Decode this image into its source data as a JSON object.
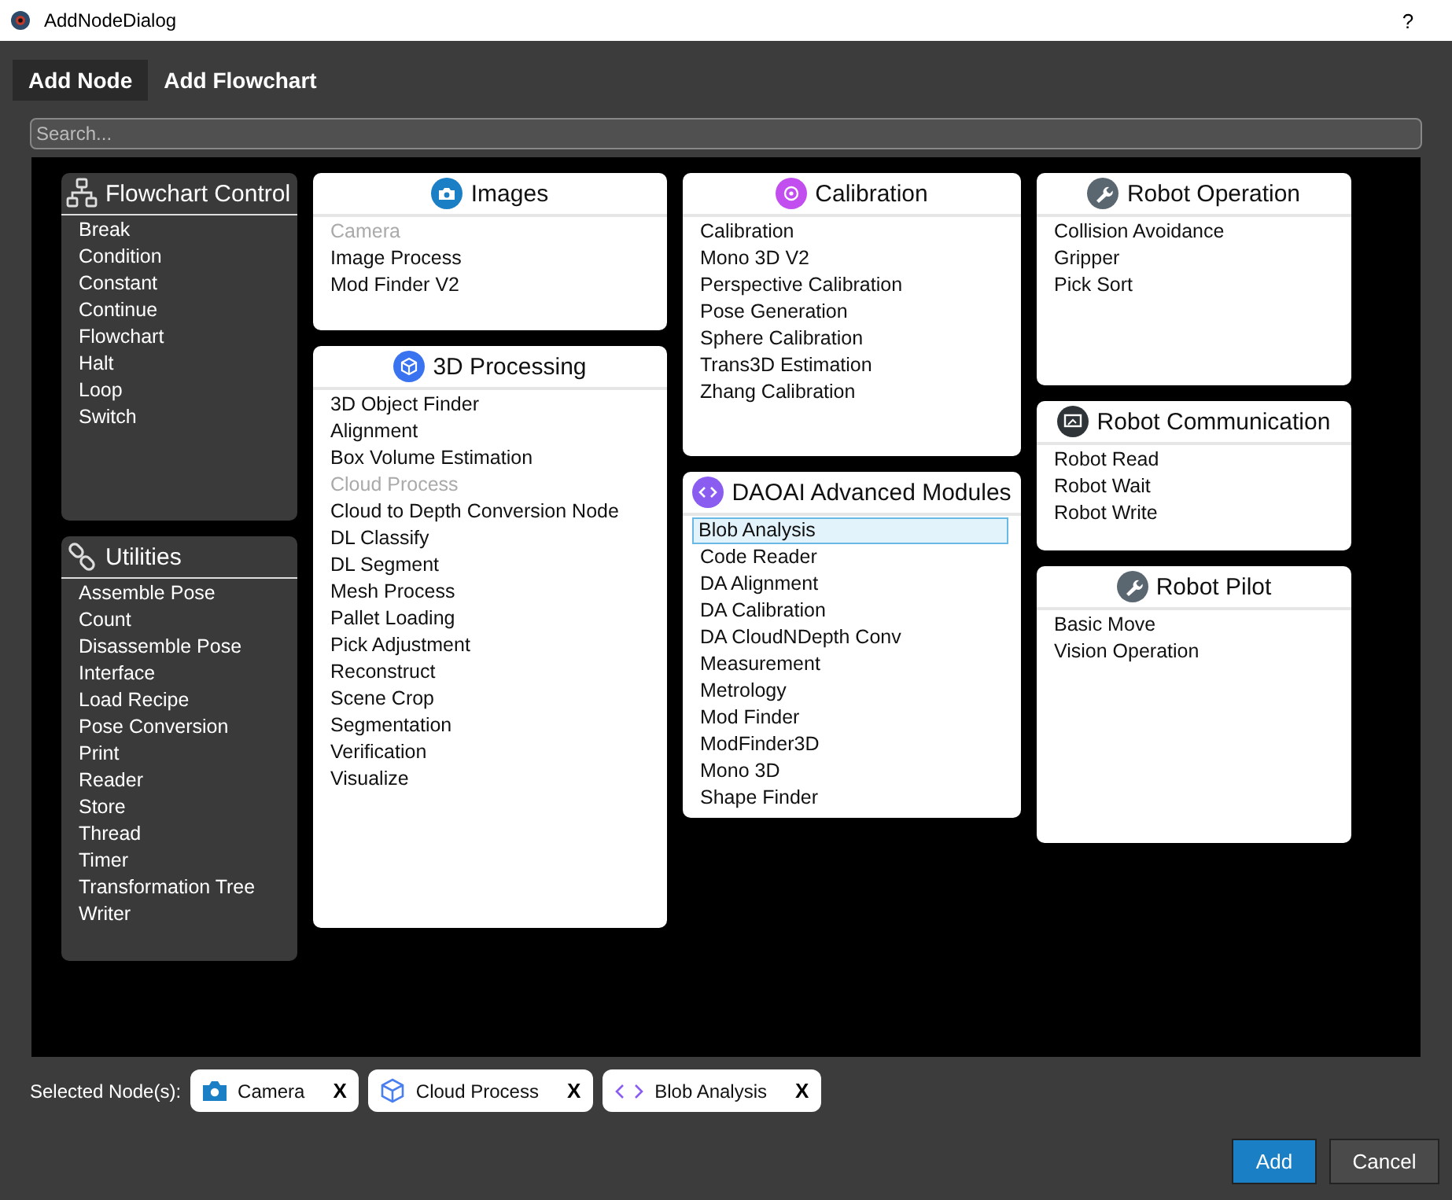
{
  "window": {
    "title": "AddNodeDialog",
    "help": "?"
  },
  "tabs": [
    {
      "label": "Add Node",
      "selected": true
    },
    {
      "label": "Add Flowchart",
      "selected": false
    }
  ],
  "search": {
    "placeholder": "Search..."
  },
  "columns": [
    {
      "cards": [
        {
          "title": "Flowchart Control",
          "items": [
            {
              "label": "Break",
              "disabled": false,
              "selected": false
            },
            {
              "label": "Condition",
              "disabled": false,
              "selected": false
            },
            {
              "label": "Constant",
              "disabled": false,
              "selected": false
            },
            {
              "label": "Continue",
              "disabled": false,
              "selected": false
            },
            {
              "label": "Flowchart",
              "disabled": false,
              "selected": false
            },
            {
              "label": "Halt",
              "disabled": false,
              "selected": false
            },
            {
              "label": "Loop",
              "disabled": false,
              "selected": false
            },
            {
              "label": "Switch",
              "disabled": false,
              "selected": false
            }
          ]
        },
        {
          "title": "Utilities",
          "items": [
            {
              "label": "Assemble Pose",
              "disabled": false,
              "selected": false
            },
            {
              "label": "Count",
              "disabled": false,
              "selected": false
            },
            {
              "label": "Disassemble Pose",
              "disabled": false,
              "selected": false
            },
            {
              "label": "Interface",
              "disabled": false,
              "selected": false
            },
            {
              "label": "Load Recipe",
              "disabled": false,
              "selected": false
            },
            {
              "label": "Pose Conversion",
              "disabled": false,
              "selected": false
            },
            {
              "label": "Print",
              "disabled": false,
              "selected": false
            },
            {
              "label": "Reader",
              "disabled": false,
              "selected": false
            },
            {
              "label": "Store",
              "disabled": false,
              "selected": false
            },
            {
              "label": "Thread",
              "disabled": false,
              "selected": false
            },
            {
              "label": "Timer",
              "disabled": false,
              "selected": false
            },
            {
              "label": "Transformation Tree",
              "disabled": false,
              "selected": false
            },
            {
              "label": "Writer",
              "disabled": false,
              "selected": false
            }
          ]
        }
      ]
    },
    {
      "cards": [
        {
          "title": "Images",
          "items": [
            {
              "label": "Camera",
              "disabled": true,
              "selected": false
            },
            {
              "label": "Image Process",
              "disabled": false,
              "selected": false
            },
            {
              "label": "Mod Finder V2",
              "disabled": false,
              "selected": false
            }
          ]
        },
        {
          "title": "3D Processing",
          "items": [
            {
              "label": "3D Object Finder",
              "disabled": false,
              "selected": false
            },
            {
              "label": "Alignment",
              "disabled": false,
              "selected": false
            },
            {
              "label": "Box Volume Estimation",
              "disabled": false,
              "selected": false
            },
            {
              "label": "Cloud Process",
              "disabled": true,
              "selected": false
            },
            {
              "label": "Cloud to Depth Conversion Node",
              "disabled": false,
              "selected": false
            },
            {
              "label": "DL Classify",
              "disabled": false,
              "selected": false
            },
            {
              "label": "DL Segment",
              "disabled": false,
              "selected": false
            },
            {
              "label": "Mesh Process",
              "disabled": false,
              "selected": false
            },
            {
              "label": "Pallet Loading",
              "disabled": false,
              "selected": false
            },
            {
              "label": "Pick Adjustment",
              "disabled": false,
              "selected": false
            },
            {
              "label": "Reconstruct",
              "disabled": false,
              "selected": false
            },
            {
              "label": "Scene Crop",
              "disabled": false,
              "selected": false
            },
            {
              "label": "Segmentation",
              "disabled": false,
              "selected": false
            },
            {
              "label": "Verification",
              "disabled": false,
              "selected": false
            },
            {
              "label": "Visualize",
              "disabled": false,
              "selected": false
            }
          ]
        }
      ]
    },
    {
      "cards": [
        {
          "title": "Calibration",
          "items": [
            {
              "label": "Calibration",
              "disabled": false,
              "selected": false
            },
            {
              "label": "Mono 3D V2",
              "disabled": false,
              "selected": false
            },
            {
              "label": "Perspective Calibration",
              "disabled": false,
              "selected": false
            },
            {
              "label": "Pose Generation",
              "disabled": false,
              "selected": false
            },
            {
              "label": "Sphere Calibration",
              "disabled": false,
              "selected": false
            },
            {
              "label": "Trans3D Estimation",
              "disabled": false,
              "selected": false
            },
            {
              "label": "Zhang Calibration",
              "disabled": false,
              "selected": false
            }
          ]
        },
        {
          "title": "DAOAI Advanced Modules",
          "items": [
            {
              "label": "Blob Analysis",
              "disabled": false,
              "selected": true
            },
            {
              "label": "Code Reader",
              "disabled": false,
              "selected": false
            },
            {
              "label": "DA Alignment",
              "disabled": false,
              "selected": false
            },
            {
              "label": "DA Calibration",
              "disabled": false,
              "selected": false
            },
            {
              "label": "DA CloudNDepth Conv",
              "disabled": false,
              "selected": false
            },
            {
              "label": "Measurement",
              "disabled": false,
              "selected": false
            },
            {
              "label": "Metrology",
              "disabled": false,
              "selected": false
            },
            {
              "label": "Mod Finder",
              "disabled": false,
              "selected": false
            },
            {
              "label": "ModFinder3D",
              "disabled": false,
              "selected": false
            },
            {
              "label": "Mono 3D",
              "disabled": false,
              "selected": false
            },
            {
              "label": "Shape Finder",
              "disabled": false,
              "selected": false
            }
          ]
        }
      ]
    },
    {
      "cards": [
        {
          "title": "Robot Operation",
          "items": [
            {
              "label": "Collision Avoidance",
              "disabled": false,
              "selected": false
            },
            {
              "label": "Gripper",
              "disabled": false,
              "selected": false
            },
            {
              "label": "Pick Sort",
              "disabled": false,
              "selected": false
            }
          ]
        },
        {
          "title": "Robot Communication",
          "items": [
            {
              "label": "Robot Read",
              "disabled": false,
              "selected": false
            },
            {
              "label": "Robot Wait",
              "disabled": false,
              "selected": false
            },
            {
              "label": "Robot Write",
              "disabled": false,
              "selected": false
            }
          ]
        },
        {
          "title": "Robot Pilot",
          "items": [
            {
              "label": "Basic Move",
              "disabled": false,
              "selected": false
            },
            {
              "label": "Vision Operation",
              "disabled": false,
              "selected": false
            }
          ]
        }
      ]
    }
  ],
  "selected_nodes": {
    "label": "Selected Node(s):",
    "chips": [
      {
        "label": "Camera",
        "remove": "X"
      },
      {
        "label": "Cloud Process",
        "remove": "X"
      },
      {
        "label": "Blob Analysis",
        "remove": "X"
      }
    ]
  },
  "buttons": [
    {
      "label": "Add",
      "kind": "primary"
    },
    {
      "label": "Cancel",
      "kind": "secondary"
    }
  ]
}
